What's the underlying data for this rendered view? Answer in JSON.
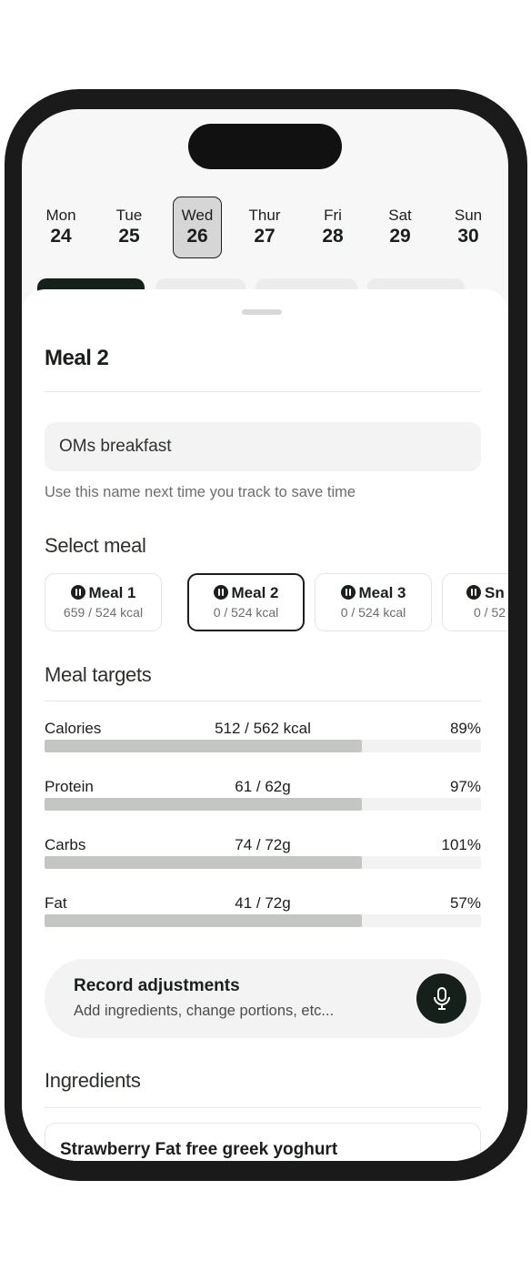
{
  "week": [
    {
      "day": "Mon",
      "date": "24",
      "active": false
    },
    {
      "day": "Tue",
      "date": "25",
      "active": false
    },
    {
      "day": "Wed",
      "date": "26",
      "active": true
    },
    {
      "day": "Thur",
      "date": "27",
      "active": false
    },
    {
      "day": "Fri",
      "date": "28",
      "active": false
    },
    {
      "day": "Sat",
      "date": "29",
      "active": false
    },
    {
      "day": "Sun",
      "date": "30",
      "active": false
    }
  ],
  "sheet": {
    "title": "Meal 2",
    "name_input_value": "OMs breakfast",
    "name_hint": "Use this name next time you track to save time"
  },
  "select_meal": {
    "heading": "Select meal",
    "meals": [
      {
        "name": "Meal 1",
        "kcal": "659 / 524 kcal",
        "selected": false
      },
      {
        "name": "Meal 2",
        "kcal": "0 / 524 kcal",
        "selected": true
      },
      {
        "name": "Meal 3",
        "kcal": "0 / 524 kcal",
        "selected": false
      },
      {
        "name": "Sn",
        "kcal": "0 / 52",
        "selected": false
      }
    ]
  },
  "meal_targets": {
    "heading": "Meal targets",
    "items": [
      {
        "label": "Calories",
        "value": "512 / 562 kcal",
        "percent": "89%",
        "fill_fraction": 0.727
      },
      {
        "label": "Protein",
        "value": "61 / 62g",
        "percent": "97%",
        "fill_fraction": 0.727
      },
      {
        "label": "Carbs",
        "value": "74 / 72g",
        "percent": "101%",
        "fill_fraction": 0.727
      },
      {
        "label": "Fat",
        "value": "41 / 72g",
        "percent": "57%",
        "fill_fraction": 0.727
      }
    ]
  },
  "record": {
    "title": "Record adjustments",
    "subtitle": "Add ingredients, change portions, etc...",
    "icon": "microphone-icon"
  },
  "ingredients": {
    "heading": "Ingredients",
    "items": [
      {
        "name": "Strawberry Fat free greek yoghurt"
      }
    ]
  },
  "colors": {
    "accent_dark": "#16201a",
    "progress_fill": "#c4c6c3",
    "progress_track": "#f2f2f2"
  }
}
